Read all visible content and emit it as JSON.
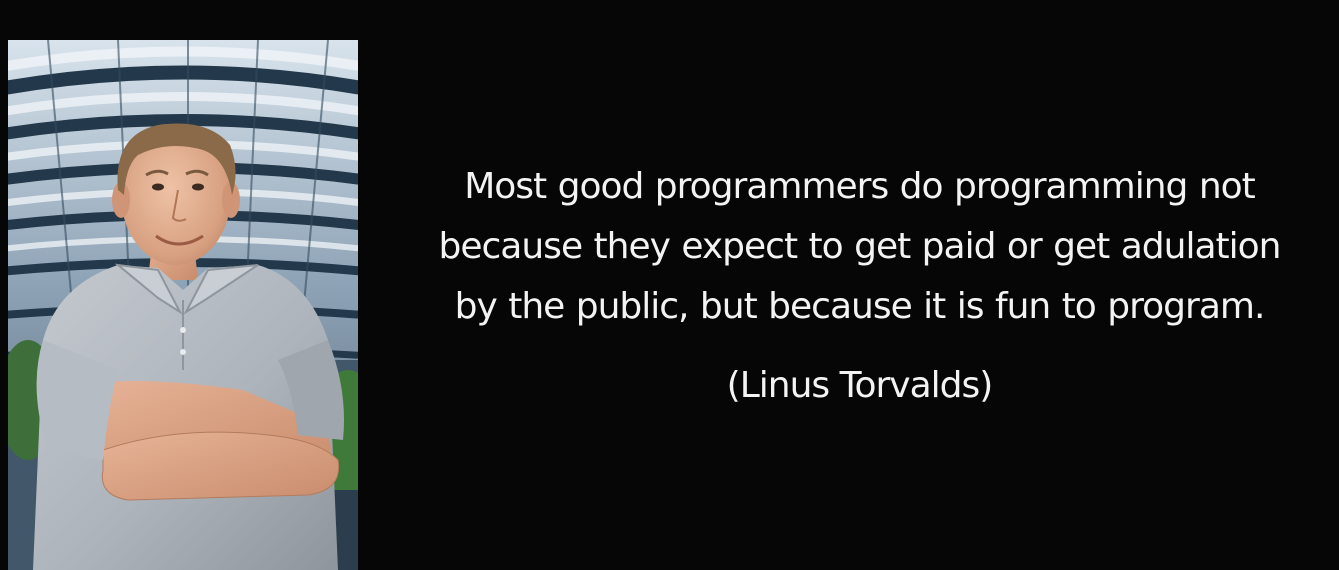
{
  "quote": {
    "lines": [
      "Most good programmers do programming not",
      "because they expect to get paid or get adulation",
      "by the public, but because it is fun to program."
    ],
    "author": "(Linus Torvalds)"
  },
  "colors": {
    "background": "#060606",
    "text": "#f3f3f3",
    "shirt": "#b6bbc3",
    "skin": "#d9a283",
    "hair": "#8b6a4a"
  },
  "image": {
    "subject": "portrait-photo",
    "arms": "crossed"
  }
}
